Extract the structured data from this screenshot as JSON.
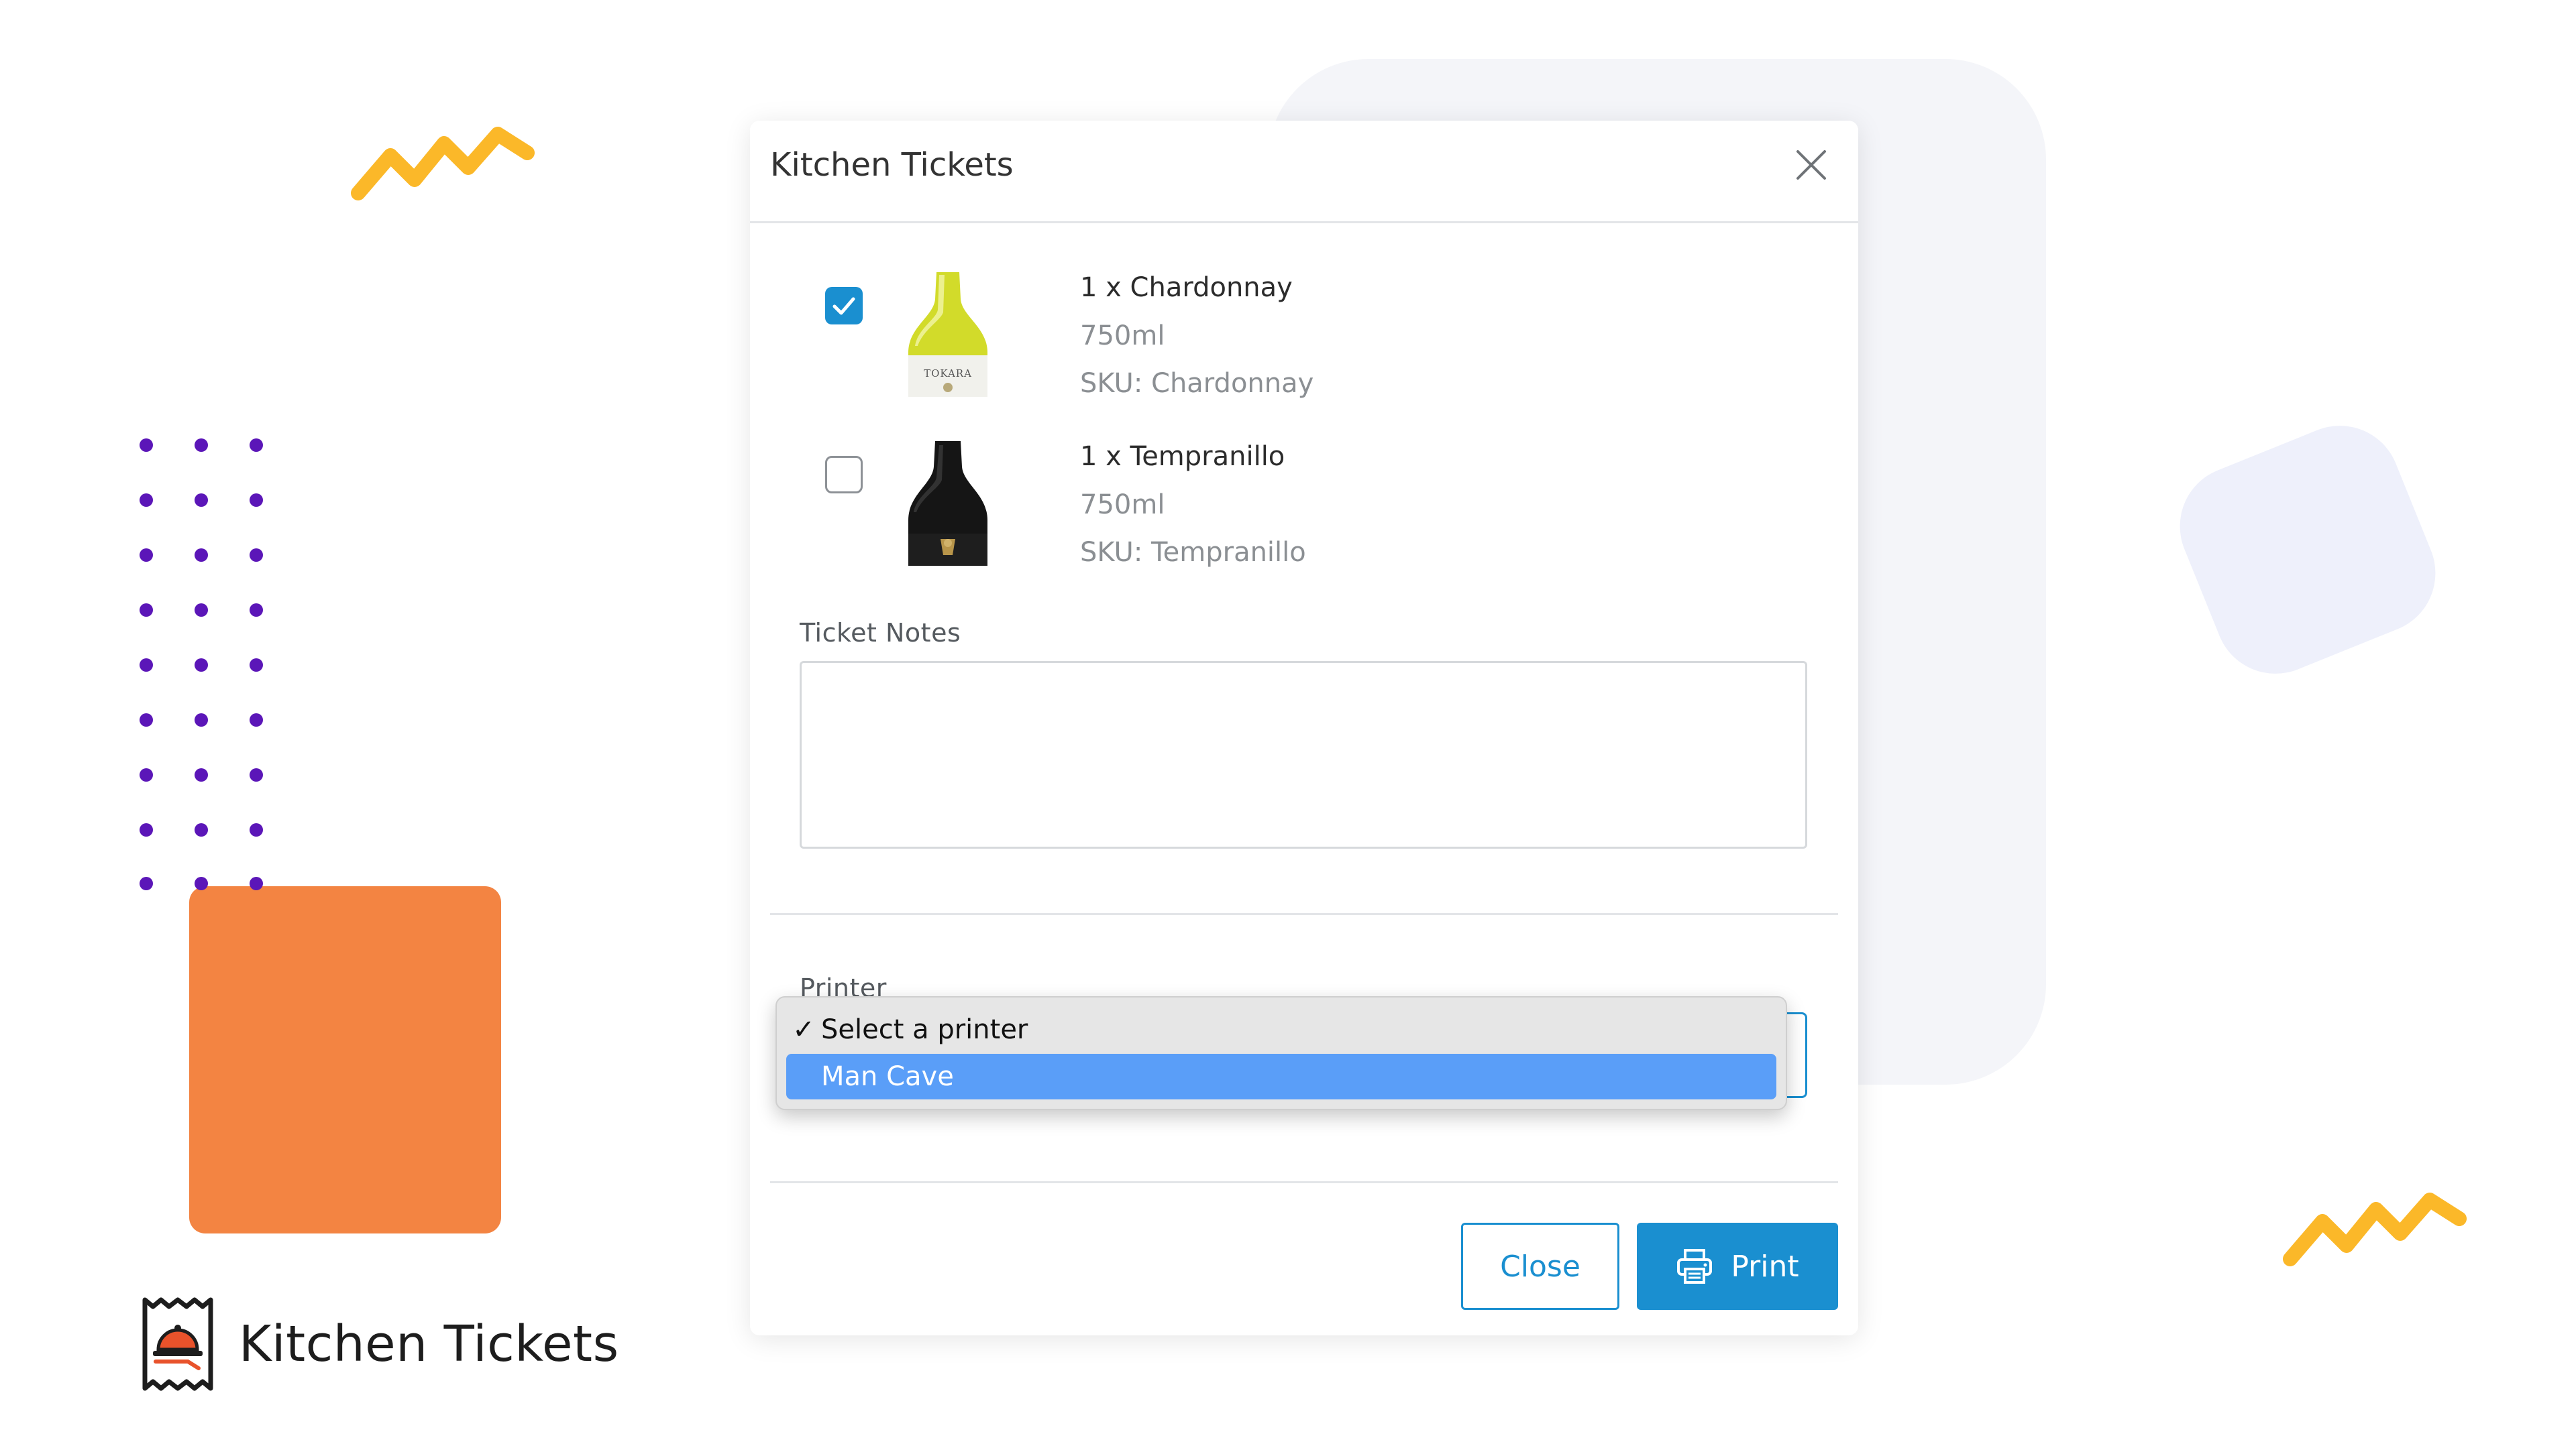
{
  "brand": {
    "name": "Kitchen Tickets",
    "icon": "receipt-cloche-icon"
  },
  "modal": {
    "title": "Kitchen Tickets",
    "items": [
      {
        "name": "1 x Chardonnay",
        "size": "750ml",
        "sku": "SKU: Chardonnay",
        "checked": true
      },
      {
        "name": "1 x Tempranillo",
        "size": "750ml",
        "sku": "SKU: Tempranillo",
        "checked": false
      }
    ],
    "notes_label": "Ticket Notes",
    "notes_value": "",
    "printer_label": "Printer",
    "printer_options": [
      {
        "label": "Select a printer",
        "checked": true
      },
      {
        "label": "Man Cave",
        "highlighted": true
      }
    ],
    "close_label": "Close",
    "print_label": "Print"
  },
  "colors": {
    "accent": "#1a8fd0",
    "orange": "#f38442",
    "yellow": "#fbb829",
    "dots": "#5b16b8",
    "highlight": "#5a9ef8"
  }
}
